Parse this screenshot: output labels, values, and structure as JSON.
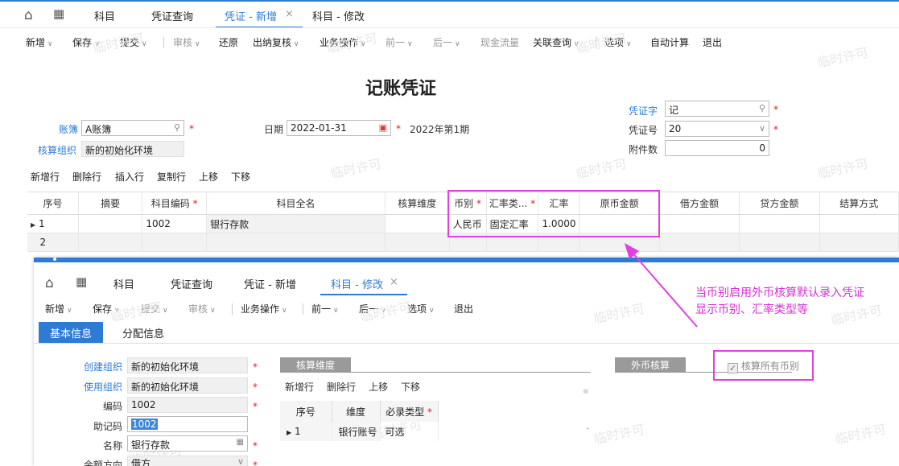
{
  "top_tabs": {
    "home_icon": "home-icon",
    "apps_icon": "grid-icon",
    "items": [
      {
        "label": "科目"
      },
      {
        "label": "凭证查询"
      },
      {
        "label": "凭证 - 新增"
      },
      {
        "label": "科目 - 修改"
      }
    ],
    "close_glyph": "×"
  },
  "toolbar": {
    "new": "新增",
    "save": "保存",
    "submit": "提交",
    "audit": "审核",
    "restore": "还原",
    "cashier_review": "出纳复核",
    "business_ops": "业务操作",
    "prev": "前一",
    "next": "后一",
    "cash_flow": "现金流量",
    "related_query": "关联查询",
    "options": "选项",
    "auto_calc": "自动计算",
    "exit": "退出"
  },
  "watermark": "临时许可",
  "voucher": {
    "title": "记账凭证",
    "book_label": "账簿",
    "book_value": "A账簿",
    "acct_org_label": "核算组织",
    "acct_org_value": "新的初始化环境",
    "date_label": "日期",
    "date_value": "2022-01-31",
    "period_text": "2022年第1期",
    "voucher_word_label": "凭证字",
    "voucher_word_value": "记",
    "voucher_no_label": "凭证号",
    "voucher_no_value": "20",
    "attach_label": "附件数",
    "attach_value": "0",
    "required_mark": "*"
  },
  "entry_toolbar": {
    "add_row": "新增行",
    "delete_row": "删除行",
    "insert_row": "插入行",
    "copy_row": "复制行",
    "move_up": "上移",
    "move_down": "下移"
  },
  "grid": {
    "headers": [
      "序号",
      "摘要",
      "科目编码",
      "科目全名",
      "核算维度",
      "币别",
      "汇率类...",
      "汇率",
      "原币金额",
      "借方金额",
      "贷方金额",
      "结算方式"
    ],
    "rows": [
      {
        "seq": "1",
        "summary": "",
        "acct_code": "1002",
        "acct_name": "银行存款",
        "dim": "",
        "currency": "人民币",
        "rate_type": "固定汇率",
        "rate": "1.0000",
        "orig": "",
        "debit": "",
        "credit": "",
        "settle": ""
      },
      {
        "seq": "2",
        "summary": "",
        "acct_code": "",
        "acct_name": "",
        "dim": "",
        "currency": "",
        "rate_type": "",
        "rate": "",
        "orig": "",
        "debit": "",
        "credit": "",
        "settle": ""
      }
    ]
  },
  "overlay": {
    "tabs": [
      {
        "label": "科目"
      },
      {
        "label": "凭证查询"
      },
      {
        "label": "凭证 - 新增"
      },
      {
        "label": "科目 - 修改"
      }
    ],
    "toolbar": {
      "new": "新增",
      "save": "保存",
      "submit": "提交",
      "audit": "审核",
      "business_ops": "业务操作",
      "prev": "前一",
      "next": "后一",
      "options": "选项",
      "exit": "退出"
    },
    "subtabs": [
      "基本信息",
      "分配信息"
    ],
    "form": {
      "create_org_label": "创建组织",
      "create_org_value": "新的初始化环境",
      "use_org_label": "使用组织",
      "use_org_value": "新的初始化环境",
      "code_label": "编码",
      "code_value": "1002",
      "mnemonic_label": "助记码",
      "mnemonic_value": "1002",
      "name_label": "名称",
      "name_value": "银行存款",
      "balance_dir_label": "余额方向",
      "balance_dir_value": "借方"
    },
    "dim_section": {
      "title": "核算维度",
      "add_row": "新增行",
      "delete_row": "删除行",
      "move_up": "上移",
      "move_down": "下移",
      "headers": [
        "序号",
        "维度",
        "必录类型"
      ],
      "rows": [
        {
          "seq": "1",
          "dim": "银行账号",
          "type": "可选"
        }
      ]
    },
    "fx_section": {
      "title": "外币核算",
      "checkbox_label": "核算所有币别",
      "checked": true
    }
  },
  "annotation": {
    "line1": "当币别启用外币核算默认录入凭证",
    "line2": "显示币别、汇率类型等",
    "color": "#d530d5"
  }
}
